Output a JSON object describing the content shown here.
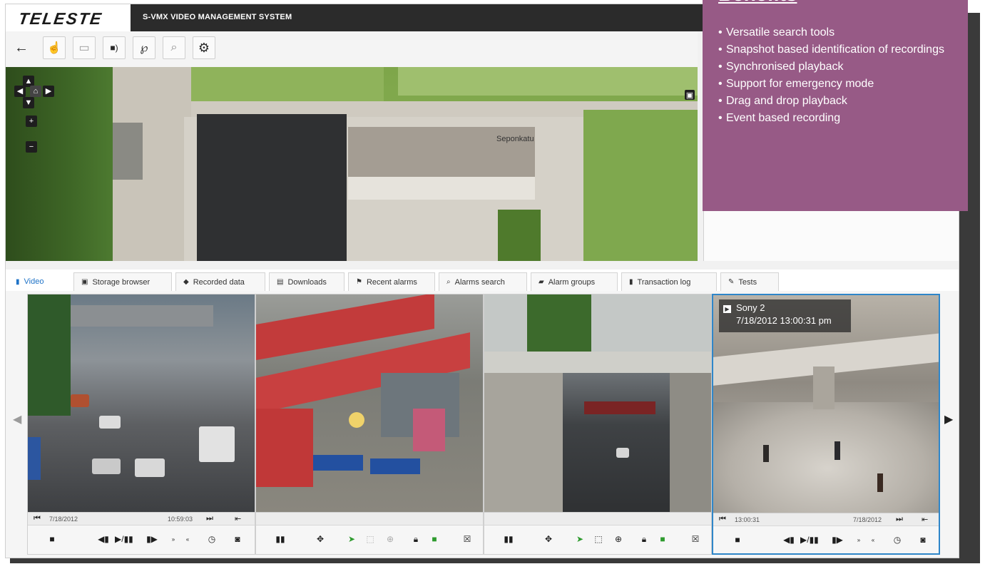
{
  "header": {
    "logo": "TELESTE",
    "product_name": "S-VMX VIDEO MANAGEMENT SYSTEM"
  },
  "toolbar": {
    "tools": [
      {
        "name": "back-arrow-icon",
        "glyph": "←"
      },
      {
        "name": "hand-pan-icon",
        "glyph": "☝"
      },
      {
        "name": "rectangle-select-icon",
        "glyph": "▭"
      },
      {
        "name": "camera-sound-icon",
        "glyph": "■)"
      },
      {
        "name": "lasso-icon",
        "glyph": "℘"
      },
      {
        "name": "zoom-region-icon",
        "glyph": "⌕"
      },
      {
        "name": "gear-icon",
        "glyph": "⚙"
      }
    ]
  },
  "map": {
    "road_label": "Seponkatu",
    "controls": {
      "home": "⌂",
      "zoom_in": "+",
      "zoom_out": "−"
    }
  },
  "tabs": [
    {
      "label": "Video",
      "icon": "▮",
      "active": true
    },
    {
      "label": "Storage browser",
      "icon": "▣",
      "active": false
    },
    {
      "label": "Recorded data",
      "icon": "◆",
      "active": false
    },
    {
      "label": "Downloads",
      "icon": "▤",
      "active": false
    },
    {
      "label": "Recent alarms",
      "icon": "⚑",
      "active": false
    },
    {
      "label": "Alarms search",
      "icon": "⌕",
      "active": false
    },
    {
      "label": "Alarm groups",
      "icon": "▰",
      "active": false
    },
    {
      "label": "Transaction log",
      "icon": "▮",
      "active": false
    },
    {
      "label": "Tests",
      "icon": "✎",
      "active": false
    }
  ],
  "cameras": [
    {
      "timeline_left": "7/18/2012",
      "timeline_right": "10:59:03",
      "scene": "street"
    },
    {
      "timeline_left": "",
      "timeline_right": "",
      "scene": "station"
    },
    {
      "timeline_left": "",
      "timeline_right": "",
      "scene": "tunnel"
    },
    {
      "timeline_left": "13:00:31",
      "timeline_right": "7/18/2012",
      "scene": "stairs",
      "overlay_name": "Sony 2",
      "overlay_time": "7/18/2012 13:00:31 pm"
    }
  ],
  "benefits": {
    "title": "Benefits",
    "items": [
      "Versatile search tools",
      "Snapshot based identification of recordings",
      "Synchronised playback",
      "Support for emergency mode",
      "Drag and drop playback",
      "Event based recording"
    ]
  },
  "colors": {
    "accent": "#1f73c7",
    "benefits_bg": "#975a86",
    "header_bg": "#2b2b2b",
    "selected_border": "#2f86c9"
  }
}
